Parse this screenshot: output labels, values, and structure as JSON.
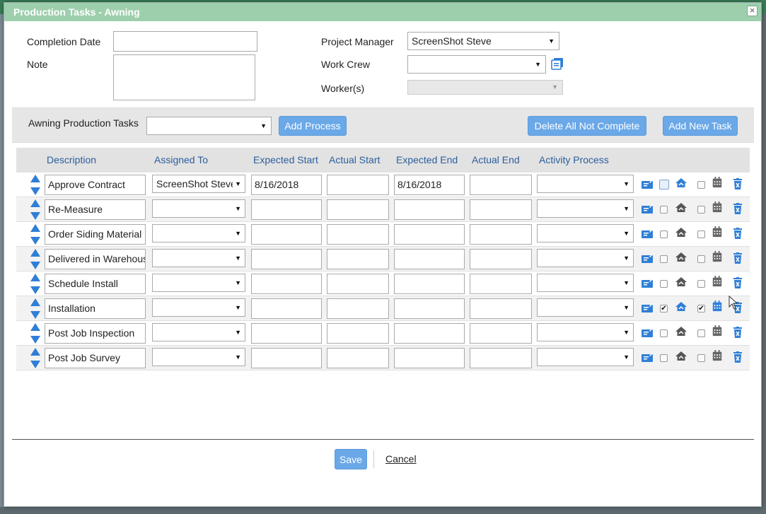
{
  "dialog": {
    "title": "Production Tasks - Awning",
    "close_label": "×"
  },
  "form": {
    "completion_date_label": "Completion Date",
    "completion_date_value": "",
    "note_label": "Note",
    "note_value": "",
    "project_manager_label": "Project Manager",
    "project_manager_value": "ScreenShot Steve",
    "work_crew_label": "Work Crew",
    "work_crew_value": "",
    "workers_label": "Worker(s)",
    "workers_value": ""
  },
  "toolbar": {
    "production_tasks_label": "Awning Production Tasks",
    "production_tasks_value": "",
    "add_process": "Add Process",
    "delete_all": "Delete All Not Complete",
    "add_new_task": "Add New Task"
  },
  "columns": {
    "description": "Description",
    "assigned_to": "Assigned To",
    "expected_start": "Expected Start",
    "actual_start": "Actual Start",
    "expected_end": "Expected End",
    "actual_end": "Actual End",
    "activity_process": "Activity Process"
  },
  "rows": [
    {
      "description": "Approve Contract",
      "assigned_to": "ScreenShot Steve",
      "expected_start": "8/16/2018",
      "actual_start": "",
      "expected_end": "8/16/2018",
      "actual_end": "",
      "activity_process": ""
    },
    {
      "description": "Re-Measure",
      "assigned_to": "",
      "expected_start": "",
      "actual_start": "",
      "expected_end": "",
      "actual_end": "",
      "activity_process": ""
    },
    {
      "description": "Order Siding Material",
      "assigned_to": "",
      "expected_start": "",
      "actual_start": "",
      "expected_end": "",
      "actual_end": "",
      "activity_process": ""
    },
    {
      "description": "Delivered in Warehouse",
      "assigned_to": "",
      "expected_start": "",
      "actual_start": "",
      "expected_end": "",
      "actual_end": "",
      "activity_process": ""
    },
    {
      "description": "Schedule Install",
      "assigned_to": "",
      "expected_start": "",
      "actual_start": "",
      "expected_end": "",
      "actual_end": "",
      "activity_process": ""
    },
    {
      "description": "Installation",
      "assigned_to": "",
      "expected_start": "",
      "actual_start": "",
      "expected_end": "",
      "actual_end": "",
      "activity_process": ""
    },
    {
      "description": "Post Job Inspection",
      "assigned_to": "",
      "expected_start": "",
      "actual_start": "",
      "expected_end": "",
      "actual_end": "",
      "activity_process": ""
    },
    {
      "description": "Post Job Survey",
      "assigned_to": "",
      "expected_start": "",
      "actual_start": "",
      "expected_end": "",
      "actual_end": "",
      "activity_process": ""
    }
  ],
  "footer": {
    "save": "Save",
    "cancel": "Cancel"
  },
  "colors": {
    "accent": "#6aa8e8",
    "title_bar": "#9ecfad",
    "header_text": "#2c5e9c",
    "icon_blue": "#2f7fd6"
  }
}
